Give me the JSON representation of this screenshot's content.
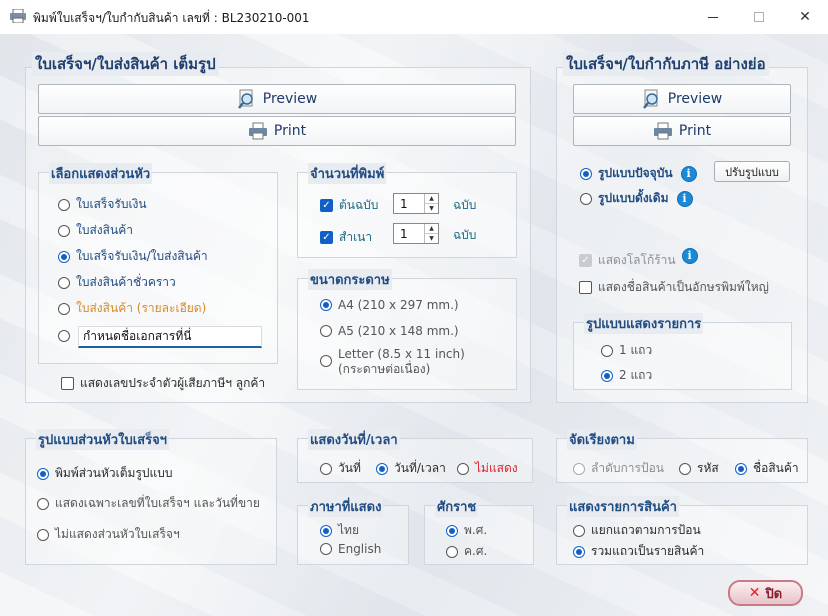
{
  "window": {
    "title": "พิมพ์ใบเสร็จฯ/ใบกำกับสินค้า เลขที่ : BL230210-001",
    "minimize_icon": "minimize-icon",
    "maximize_icon": "maximize-icon",
    "close_glyph": "✕"
  },
  "left_panel": {
    "title": "ใบเสร็จฯ/ใบส่งสินค้า เต็มรูป",
    "preview_label": "Preview",
    "print_label": "Print",
    "header_group": {
      "title": "เลือกแสดงส่วนหัว",
      "options": [
        {
          "label": "ใบเสร็จรับเงิน",
          "selected": false,
          "color": "#214c82"
        },
        {
          "label": "ใบส่งสินค้า",
          "selected": false,
          "color": "#214c82"
        },
        {
          "label": "ใบเสร็จรับเงิน/ใบส่งสินค้า",
          "selected": true,
          "color": "#214c82"
        },
        {
          "label": "ใบส่งสินค้าชั่วคราว",
          "selected": false,
          "color": "#214c82"
        },
        {
          "label": "ใบส่งสินค้า (รายละเอียด)",
          "selected": false,
          "color": "#d88a2a"
        },
        {
          "label": "",
          "selected": false
        }
      ],
      "custom_input_value": "กำหนดชื่อเอกสารที่นี่"
    },
    "copies_group": {
      "title": "จำนวนที่พิมพ์",
      "original_label": "ต้นฉบับ",
      "original_checked": true,
      "original_value": "1",
      "original_unit": "ฉบับ",
      "copy_label": "สำเนา",
      "copy_checked": true,
      "copy_value": "1",
      "copy_unit": "ฉบับ"
    },
    "paper_group": {
      "title": "ขนาดกระดาษ",
      "options": [
        {
          "label": "A4 (210 x 297 mm.)",
          "selected": true
        },
        {
          "label": "A5 (210 x 148 mm.)",
          "selected": false
        },
        {
          "label": "Letter (8.5 x 11 inch)",
          "label2": "(กระดาษต่อเนื่อง)",
          "selected": false
        }
      ]
    },
    "show_taxid_label": "แสดงเลขประจำตัวผู้เสียภาษีฯ ลูกค้า",
    "show_taxid_checked": false
  },
  "right_panel": {
    "title": "ใบเสร็จฯ/ใบกำกับภาษี อย่างย่อ",
    "preview_label": "Preview",
    "print_label": "Print",
    "current_format_label": "รูปแบบปัจจุบัน",
    "current_format_selected": true,
    "adjust_button_label": "ปรับรูปแบบ",
    "legacy_format_label": "รูปแบบดั้งเดิม",
    "legacy_format_selected": false,
    "show_logo_label": "แสดงโลโก้ร้าน",
    "show_logo_checked": true,
    "large_font_label": "แสดงชื่อสินค้าเป็นอักษรพิมพ์ใหญ่",
    "large_font_checked": false,
    "list_group": {
      "title": "รูปแบบแสดงรายการ",
      "options": [
        {
          "label": "1 แถว",
          "selected": false
        },
        {
          "label": "2 แถว",
          "selected": true
        }
      ]
    }
  },
  "header_style_group": {
    "title": "รูปแบบส่วนหัวใบเสร็จฯ",
    "options": [
      {
        "label": "พิมพ์ส่วนหัวเต็มรูปแบบ",
        "selected": true
      },
      {
        "label": "แสดงเฉพาะเลขที่ใบเสร็จฯ และวันที่ขาย",
        "selected": false
      },
      {
        "label": "ไม่แสดงส่วนหัวใบเสร็จฯ",
        "selected": false
      }
    ]
  },
  "datetime_group": {
    "title": "แสดงวันที่/เวลา",
    "options": [
      {
        "label": "วันที่",
        "selected": false,
        "color": "#2b2b2b"
      },
      {
        "label": "วันที่/เวลา",
        "selected": true,
        "color": "#2b2b2b"
      },
      {
        "label": "ไม่แสดง",
        "selected": false,
        "color": "#e0202a"
      }
    ]
  },
  "language_group": {
    "title": "ภาษาที่แสดง",
    "options": [
      {
        "label": "ไทย",
        "selected": true
      },
      {
        "label": "English",
        "selected": false
      }
    ]
  },
  "era_group": {
    "title": "ศักราช",
    "options": [
      {
        "label": "พ.ศ.",
        "selected": true
      },
      {
        "label": "ค.ศ.",
        "selected": false
      }
    ]
  },
  "sort_group": {
    "title": "จัดเรียงตาม",
    "options": [
      {
        "label": "ลำดับการป้อน",
        "selected": false,
        "color": "#8a8f95"
      },
      {
        "label": "รหัส",
        "selected": false,
        "color": "#2b2b2b"
      },
      {
        "label": "ชื่อสินค้า",
        "selected": true,
        "color": "#2b2b2b"
      }
    ]
  },
  "item_display_group": {
    "title": "แสดงรายการสินค้า",
    "options": [
      {
        "label": "แยกแถวตามการป้อน",
        "selected": false
      },
      {
        "label": "รวมแถวเป็นรายสินค้า",
        "selected": true
      }
    ]
  },
  "close_button": {
    "label": "ปิด",
    "icon": "close-icon"
  },
  "colors": {
    "accent": "#1160c8",
    "title_text": "#214c82",
    "warning": "#e0202a",
    "orange": "#d88a2a"
  }
}
